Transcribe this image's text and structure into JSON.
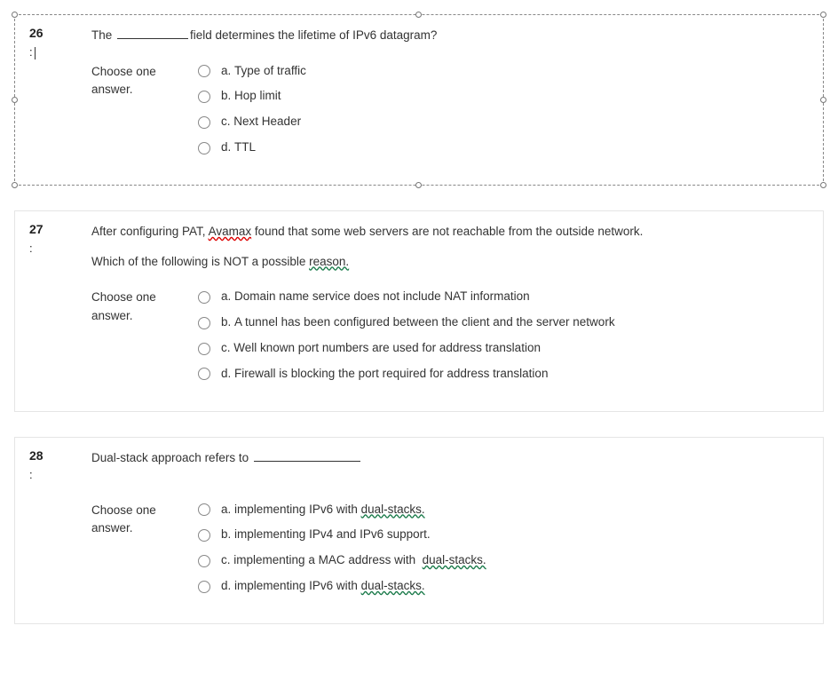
{
  "questions": [
    {
      "number": "26",
      "sub": ":",
      "text_pre": "The ",
      "text_post": "field determines the lifetime of IPv6 datagram?",
      "choose_label": "Choose one answer.",
      "options": [
        {
          "letter": "a.",
          "text": "Type of traffic"
        },
        {
          "letter": "b.",
          "text": "Hop limit"
        },
        {
          "letter": "c.",
          "text": "Next Header"
        },
        {
          "letter": "d.",
          "text": "TTL"
        }
      ]
    },
    {
      "number": "27",
      "sub": ":",
      "para1_pre": "After configuring PAT, ",
      "para1_mis": "Avamax",
      "para1_post": " found that some web servers are not reachable from the outside network.",
      "para2_pre": "Which of the following is NOT a possible ",
      "para2_g": "reason.",
      "choose_label": "Choose one answer.",
      "options": [
        {
          "letter": "a.",
          "text": "Domain name service does not include NAT information"
        },
        {
          "letter": "b.",
          "text": "A tunnel has been configured between the client and the server network"
        },
        {
          "letter": "c.",
          "text": "Well known port numbers are used for address translation"
        },
        {
          "letter": "d.",
          "text": "Firewall is blocking the port required for address translation"
        }
      ]
    },
    {
      "number": "28",
      "sub": ":",
      "text_pre": "Dual-stack approach refers to ",
      "choose_label": "Choose one answer.",
      "options": [
        {
          "letter": "a.",
          "pre": "implementing IPv6 with ",
          "g": "dual-stacks.",
          "post": ""
        },
        {
          "letter": "b.",
          "pre": "implementing IPv4 and IPv6 support.",
          "g": "",
          "post": ""
        },
        {
          "letter": "c.",
          "pre": "implementing a MAC address with ",
          "g": "dual-stacks.",
          "post": ""
        },
        {
          "letter": "d.",
          "pre": "implementing IPv6 with ",
          "g": "dual-stacks.",
          "post": ""
        }
      ]
    }
  ]
}
